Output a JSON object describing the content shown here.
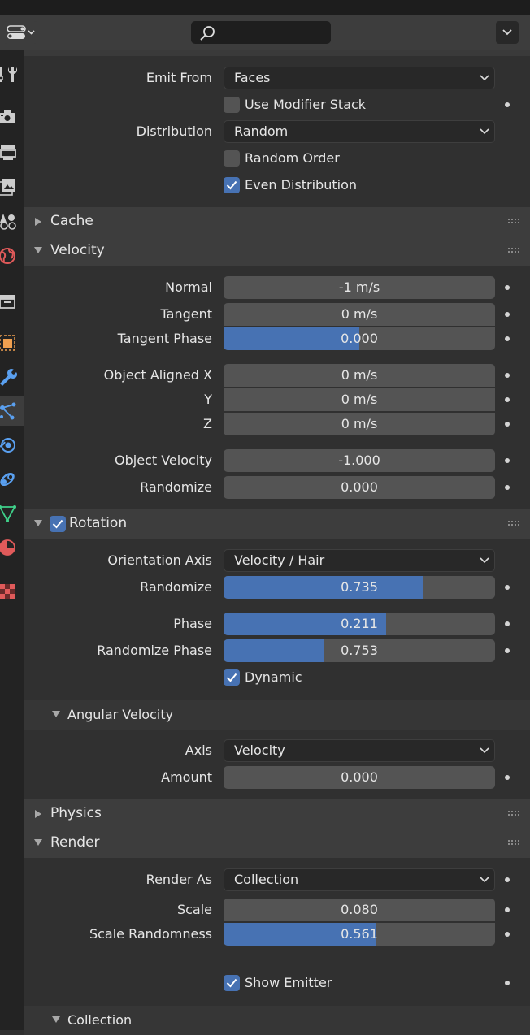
{
  "header": {
    "search": {
      "placeholder": ""
    }
  },
  "tabs": [
    {
      "icon": "tool-icon",
      "color": "#cccccc"
    },
    {
      "icon": "render-icon",
      "color": "#cccccc"
    },
    {
      "icon": "output-icon",
      "color": "#cccccc"
    },
    {
      "icon": "view-layer-icon",
      "color": "#cccccc"
    },
    {
      "icon": "scene-icon",
      "color": "#cccccc"
    },
    {
      "icon": "world-icon",
      "color": "#e05a5a"
    },
    {
      "icon": "collection-icon",
      "color": "#cccccc"
    },
    {
      "icon": "object-icon",
      "color": "#f0a050"
    },
    {
      "icon": "modifier-icon",
      "color": "#5aa0f0"
    },
    {
      "icon": "particles-icon",
      "color": "#5aa0f0"
    },
    {
      "icon": "physics-icon",
      "color": "#5aa0f0"
    },
    {
      "icon": "constraints-icon",
      "color": "#5aa0f0"
    },
    {
      "icon": "data-icon",
      "color": "#3fd08a"
    },
    {
      "icon": "material-icon",
      "color": "#e05a5a"
    },
    {
      "icon": "texture-icon",
      "color": "#e05a5a"
    }
  ],
  "emission": {
    "emit_from": {
      "label": "Emit From",
      "value": "Faces"
    },
    "use_modifier_stack": {
      "label": "Use Modifier Stack",
      "checked": false
    },
    "distribution": {
      "label": "Distribution",
      "value": "Random"
    },
    "random_order": {
      "label": "Random Order",
      "checked": false
    },
    "even_distribution": {
      "label": "Even Distribution",
      "checked": true
    }
  },
  "panels": {
    "cache": "Cache",
    "velocity": "Velocity",
    "rotation": "Rotation",
    "angular_velocity": "Angular Velocity",
    "physics": "Physics",
    "render": "Render",
    "collection": "Collection"
  },
  "velocity": {
    "normal": {
      "label": "Normal",
      "value": "-1 m/s"
    },
    "tangent": {
      "label": "Tangent",
      "value": "0 m/s"
    },
    "tangent_phase": {
      "label": "Tangent Phase",
      "value": "0.000",
      "fill": 0.5
    },
    "object_aligned_x": {
      "label": "Object Aligned X",
      "value": "0 m/s"
    },
    "y": {
      "label": "Y",
      "value": "0 m/s"
    },
    "z": {
      "label": "Z",
      "value": "0 m/s"
    },
    "object_velocity": {
      "label": "Object Velocity",
      "value": "-1.000"
    },
    "randomize": {
      "label": "Randomize",
      "value": "0.000"
    }
  },
  "rotation": {
    "enabled": true,
    "orientation_axis": {
      "label": "Orientation Axis",
      "value": "Velocity / Hair"
    },
    "randomize": {
      "label": "Randomize",
      "value": "0.735",
      "fill": 0.735
    },
    "phase": {
      "label": "Phase",
      "value": "0.211",
      "fill": 0.6
    },
    "randomize_phase": {
      "label": "Randomize Phase",
      "value": "0.753",
      "fill": 0.37
    },
    "dynamic": {
      "label": "Dynamic",
      "checked": true
    }
  },
  "angular_velocity": {
    "axis": {
      "label": "Axis",
      "value": "Velocity"
    },
    "amount": {
      "label": "Amount",
      "value": "0.000"
    }
  },
  "render": {
    "render_as": {
      "label": "Render As",
      "value": "Collection"
    },
    "scale": {
      "label": "Scale",
      "value": "0.080"
    },
    "scale_randomness": {
      "label": "Scale Randomness",
      "value": "0.561",
      "fill": 0.561
    },
    "show_emitter": {
      "label": "Show Emitter",
      "checked": true
    }
  },
  "colors": {
    "accent": "#4772b3",
    "panel_bg": "#303030",
    "header_bg": "#3d3d3d",
    "field_bg": "#545454",
    "dropdown_bg": "#282828"
  }
}
